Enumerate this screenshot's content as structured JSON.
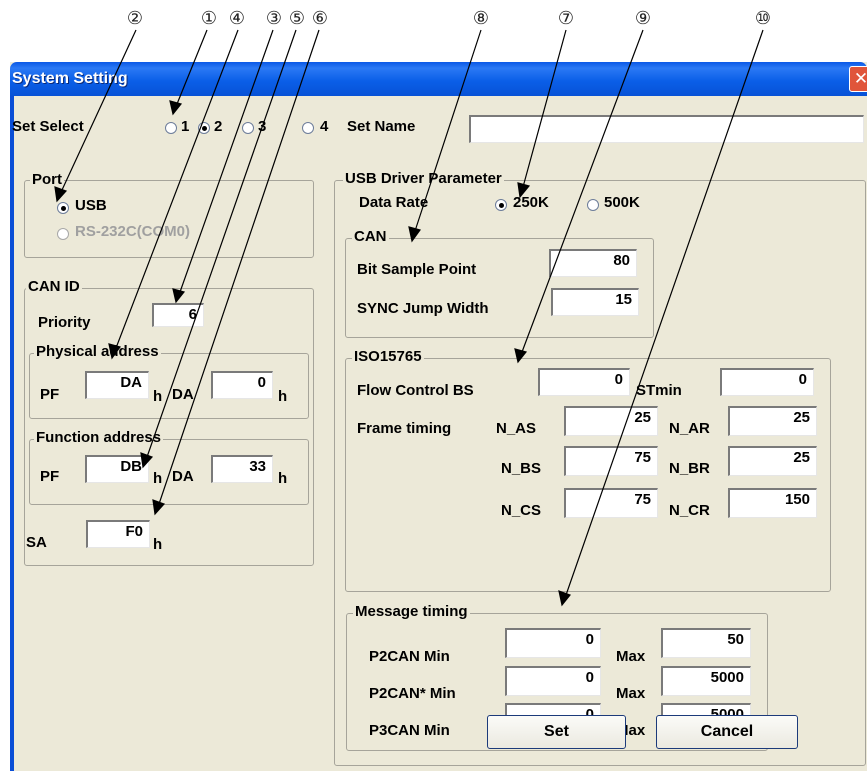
{
  "callouts": [
    "②",
    "①",
    "④",
    "③",
    "⑤",
    "⑥",
    "⑧",
    "⑦",
    "⑨",
    "⑩"
  ],
  "window": {
    "title": "System Setting",
    "close_glyph": "✕"
  },
  "set_select": {
    "label": "Set Select",
    "options": [
      "1",
      "2",
      "3",
      "4"
    ],
    "selected": "2",
    "set_name_label": "Set Name",
    "set_name_value": ""
  },
  "port": {
    "title": "Port",
    "options": [
      {
        "label": "USB",
        "selected": true,
        "enabled": true
      },
      {
        "label": "RS-232C(COM0)",
        "selected": false,
        "enabled": false
      }
    ]
  },
  "can_id": {
    "title": "CAN ID",
    "priority_label": "Priority",
    "priority_value": "6",
    "physical": {
      "title": "Physical address",
      "pf_label": "PF",
      "pf_value": "DA",
      "h": "h",
      "da_label": "DA",
      "da_value": "0"
    },
    "function": {
      "title": "Function address",
      "pf_label": "PF",
      "pf_value": "DB",
      "h": "h",
      "da_label": "DA",
      "da_value": "33"
    },
    "sa_label": "SA",
    "sa_value": "F0",
    "h": "h"
  },
  "usb_driver": {
    "title": "USB Driver Parameter",
    "data_rate_label": "Data Rate",
    "rates": [
      {
        "label": "250K",
        "selected": true
      },
      {
        "label": "500K",
        "selected": false
      }
    ],
    "can": {
      "title": "CAN",
      "bit_sample_label": "Bit Sample Point",
      "bit_sample_value": "80",
      "sync_jump_label": "SYNC Jump Width",
      "sync_jump_value": "15"
    },
    "iso": {
      "title": "ISO15765",
      "flow_bs_label": "Flow Control BS",
      "flow_bs_value": "0",
      "stmin_label": "STmin",
      "stmin_value": "0",
      "frame_timing_label": "Frame timing",
      "n_as_label": "N_AS",
      "n_as_value": "25",
      "n_ar_label": "N_AR",
      "n_ar_value": "25",
      "n_bs_label": "N_BS",
      "n_bs_value": "75",
      "n_br_label": "N_BR",
      "n_br_value": "25",
      "n_cs_label": "N_CS",
      "n_cs_value": "75",
      "n_cr_label": "N_CR",
      "n_cr_value": "150"
    },
    "msg": {
      "title": "Message timing",
      "max_label": "Max",
      "p2can_label": "P2CAN Min",
      "p2can_min": "0",
      "p2can_max": "50",
      "p2can_star_label": "P2CAN* Min",
      "p2can_star_min": "0",
      "p2can_star_max": "5000",
      "p3can_label": "P3CAN Min",
      "p3can_min": "0",
      "p3can_max": "5000"
    }
  },
  "buttons": {
    "set": "Set",
    "cancel": "Cancel"
  }
}
